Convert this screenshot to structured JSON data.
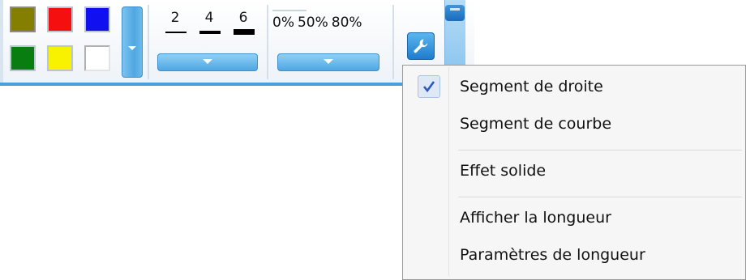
{
  "colors": {
    "swatches": [
      "#847f00",
      "#f50f0f",
      "#1010f0",
      "#0a7d10",
      "#f8f200",
      "#ffffff"
    ],
    "accent": "#4aa0d6"
  },
  "line_widths": [
    {
      "label": "2",
      "value": 2
    },
    {
      "label": "4",
      "value": 4
    },
    {
      "label": "6",
      "value": 6
    }
  ],
  "opacity": {
    "options": [
      "0%",
      "50%",
      "80%"
    ]
  },
  "toolbar": {
    "tool_icon": "wrench-icon"
  },
  "menu": {
    "items": [
      {
        "label": "Segment de droite",
        "checked": true
      },
      {
        "label": "Segment de courbe",
        "checked": false
      },
      {
        "label": "Effet solide",
        "checked": false
      },
      {
        "label": "Afficher la longueur",
        "checked": false
      },
      {
        "label": "Paramètres de longueur",
        "checked": false
      }
    ]
  }
}
